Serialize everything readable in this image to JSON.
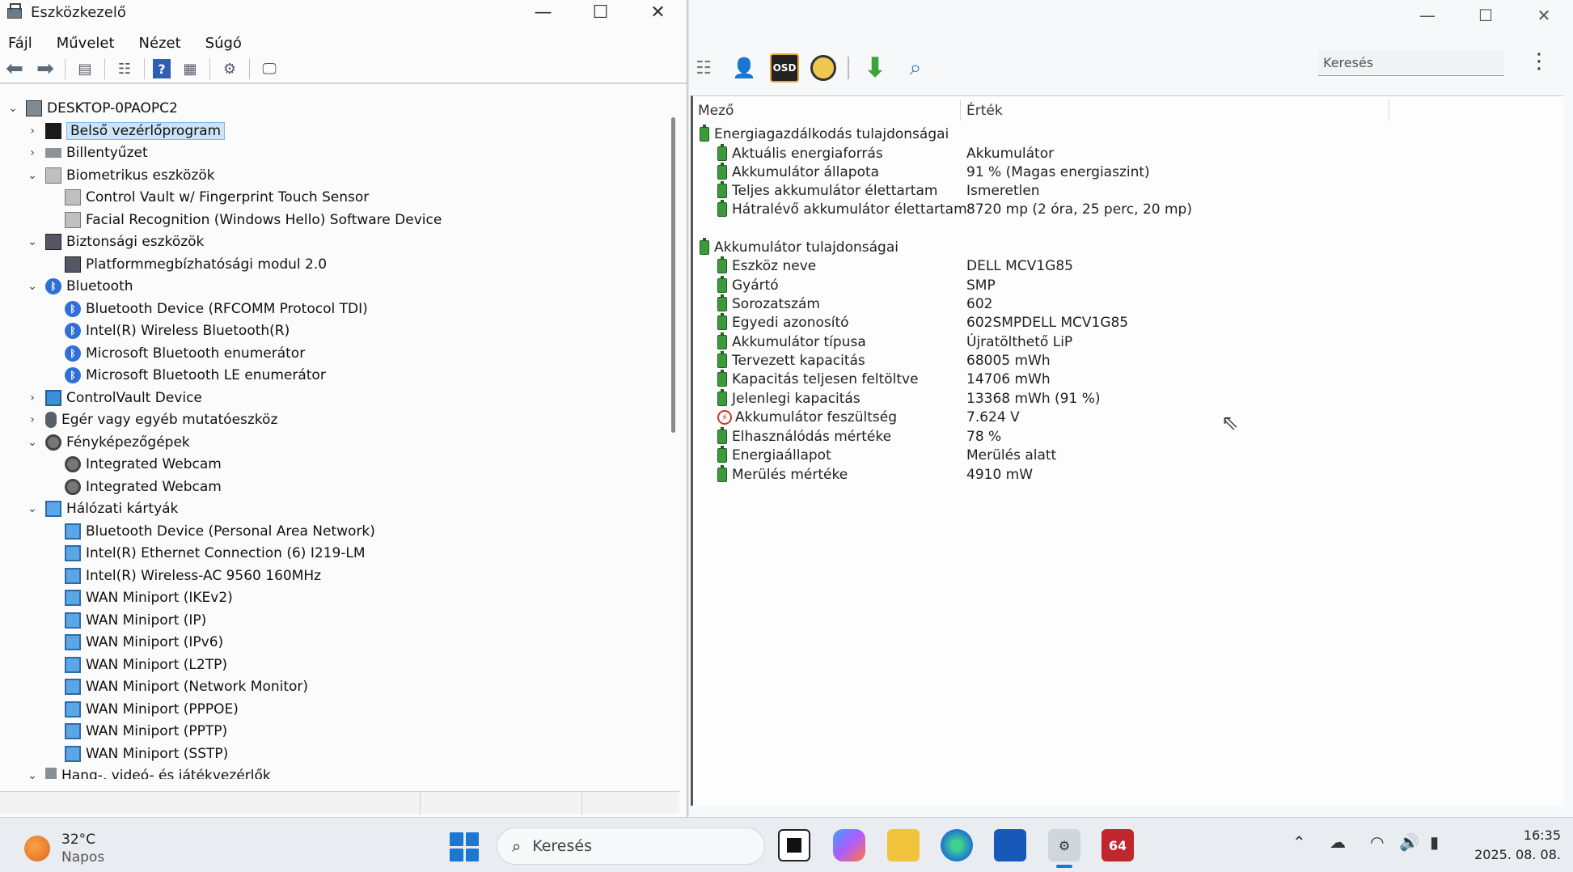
{
  "device_manager": {
    "title": "Eszközkezelő",
    "menu": [
      "Fájl",
      "Művelet",
      "Nézet",
      "Súgó"
    ],
    "tree": [
      {
        "label": "DESKTOP-0PAOPC2",
        "level": 0,
        "chevron": "v",
        "icon": "pc-icon"
      },
      {
        "label": "Belső vezérlőprogram",
        "level": 1,
        "chevron": ">",
        "icon": "firmware-icon",
        "selected": true
      },
      {
        "label": "Billentyűzet",
        "level": 1,
        "chevron": ">",
        "icon": "keyboard-icon"
      },
      {
        "label": "Biometrikus eszközök",
        "level": 1,
        "chevron": "v",
        "icon": "biometric-icon"
      },
      {
        "label": "Control Vault w/ Fingerprint Touch Sensor",
        "level": 2,
        "chevron": "",
        "icon": "biometric-icon"
      },
      {
        "label": "Facial Recognition (Windows Hello) Software Device",
        "level": 2,
        "chevron": "",
        "icon": "biometric-icon"
      },
      {
        "label": "Biztonsági eszközök",
        "level": 1,
        "chevron": "v",
        "icon": "security-icon"
      },
      {
        "label": "Platformmegbízhatósági modul 2.0",
        "level": 2,
        "chevron": "",
        "icon": "security-icon"
      },
      {
        "label": "Bluetooth",
        "level": 1,
        "chevron": "v",
        "icon": "bluetooth-icon"
      },
      {
        "label": "Bluetooth Device (RFCOMM Protocol TDI)",
        "level": 2,
        "chevron": "",
        "icon": "bluetooth-icon"
      },
      {
        "label": "Intel(R) Wireless Bluetooth(R)",
        "level": 2,
        "chevron": "",
        "icon": "bluetooth-icon"
      },
      {
        "label": "Microsoft Bluetooth enumerátor",
        "level": 2,
        "chevron": "",
        "icon": "bluetooth-icon"
      },
      {
        "label": "Microsoft Bluetooth LE enumerátor",
        "level": 2,
        "chevron": "",
        "icon": "bluetooth-icon"
      },
      {
        "label": "ControlVault Device",
        "level": 1,
        "chevron": ">",
        "icon": "monitor-icon"
      },
      {
        "label": "Egér vagy egyéb mutatóeszköz",
        "level": 1,
        "chevron": ">",
        "icon": "mouse-icon"
      },
      {
        "label": "Fényképezőgépek",
        "level": 1,
        "chevron": "v",
        "icon": "camera-icon"
      },
      {
        "label": "Integrated Webcam",
        "level": 2,
        "chevron": "",
        "icon": "camera-icon"
      },
      {
        "label": "Integrated Webcam",
        "level": 2,
        "chevron": "",
        "icon": "camera-icon"
      },
      {
        "label": "Hálózati kártyák",
        "level": 1,
        "chevron": "v",
        "icon": "network-icon"
      },
      {
        "label": "Bluetooth Device (Personal Area Network)",
        "level": 2,
        "chevron": "",
        "icon": "network-icon"
      },
      {
        "label": "Intel(R) Ethernet Connection (6) I219-LM",
        "level": 2,
        "chevron": "",
        "icon": "network-icon"
      },
      {
        "label": "Intel(R) Wireless-AC 9560 160MHz",
        "level": 2,
        "chevron": "",
        "icon": "network-icon"
      },
      {
        "label": "WAN Miniport (IKEv2)",
        "level": 2,
        "chevron": "",
        "icon": "network-icon"
      },
      {
        "label": "WAN Miniport (IP)",
        "level": 2,
        "chevron": "",
        "icon": "network-icon"
      },
      {
        "label": "WAN Miniport (IPv6)",
        "level": 2,
        "chevron": "",
        "icon": "network-icon"
      },
      {
        "label": "WAN Miniport (L2TP)",
        "level": 2,
        "chevron": "",
        "icon": "network-icon"
      },
      {
        "label": "WAN Miniport (Network Monitor)",
        "level": 2,
        "chevron": "",
        "icon": "network-icon"
      },
      {
        "label": "WAN Miniport (PPPOE)",
        "level": 2,
        "chevron": "",
        "icon": "network-icon"
      },
      {
        "label": "WAN Miniport (PPTP)",
        "level": 2,
        "chevron": "",
        "icon": "network-icon"
      },
      {
        "label": "WAN Miniport (SSTP)",
        "level": 2,
        "chevron": "",
        "icon": "network-icon"
      },
      {
        "label": "Hang-, videó- és játékvezérlők",
        "level": 1,
        "chevron": "v",
        "icon": "sound-icon"
      }
    ]
  },
  "aida": {
    "search_placeholder": "Keresés",
    "columns": {
      "field": "Mező",
      "value": "Érték"
    },
    "rows": [
      {
        "field": "Energiagazdálkodás tulajdonságai",
        "value": "",
        "group": true,
        "icon": "battery-icon"
      },
      {
        "field": "Aktuális energiaforrás",
        "value": "Akkumulátor",
        "icon": "battery-icon"
      },
      {
        "field": "Akkumulátor állapota",
        "value": "91 % (Magas energiaszint)",
        "icon": "battery-icon"
      },
      {
        "field": "Teljes akkumulátor élettartam",
        "value": "Ismeretlen",
        "icon": "battery-icon"
      },
      {
        "field": "Hátralévő akkumulátor élettartam",
        "value": "8720 mp (2 óra, 25 perc, 20 mp)",
        "icon": "battery-icon"
      },
      {
        "field": "Akkumulátor tulajdonságai",
        "value": "",
        "group": true,
        "icon": "battery-icon"
      },
      {
        "field": "Eszköz neve",
        "value": "DELL MCV1G85",
        "icon": "battery-icon"
      },
      {
        "field": "Gyártó",
        "value": "SMP",
        "icon": "battery-icon"
      },
      {
        "field": "Sorozatszám",
        "value": "602",
        "icon": "battery-icon"
      },
      {
        "field": "Egyedi azonosító",
        "value": "602SMPDELL MCV1G85",
        "icon": "battery-icon"
      },
      {
        "field": "Akkumulátor típusa",
        "value": "Újratölthető LiP",
        "icon": "battery-icon"
      },
      {
        "field": "Tervezett kapacitás",
        "value": "68005 mWh",
        "icon": "battery-icon"
      },
      {
        "field": "Kapacitás teljesen feltöltve",
        "value": "14706 mWh",
        "icon": "battery-icon"
      },
      {
        "field": "Jelenlegi kapacitás",
        "value": "13368 mWh  (91 %)",
        "icon": "battery-icon"
      },
      {
        "field": "Akkumulátor feszültség",
        "value": "7.624 V",
        "icon": "voltage-icon"
      },
      {
        "field": "Elhasználódás mértéke",
        "value": "78 %",
        "icon": "battery-icon"
      },
      {
        "field": "Energiaállapot",
        "value": "Merülés alatt",
        "icon": "battery-icon"
      },
      {
        "field": "Merülés mértéke",
        "value": "4910 mW",
        "icon": "battery-icon"
      }
    ]
  },
  "taskbar": {
    "weather_temp": "32°C",
    "weather_cond": "Napos",
    "search_label": "Keresés",
    "aida_badge": "64",
    "time": "16:35",
    "date": "2025. 08. 08."
  }
}
